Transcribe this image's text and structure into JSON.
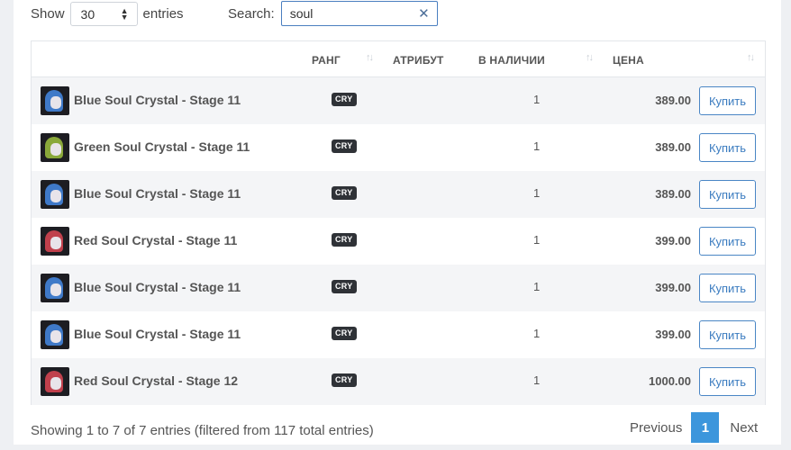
{
  "controls": {
    "show_label": "Show",
    "entries_value": "30",
    "entries_label": "entries",
    "search_label": "Search:",
    "search_value": "soul"
  },
  "table": {
    "headers": {
      "rank": "РАНГ",
      "attribute": "АТРИБУТ",
      "in_stock": "В НАЛИЧИИ",
      "price": "ЦЕНА"
    },
    "rows": [
      {
        "name": "Blue Soul Crystal - Stage 11",
        "rank": "CRY",
        "qty": "1",
        "price": "389.00",
        "buy": "Купить",
        "color": "#3f79c8"
      },
      {
        "name": "Green Soul Crystal - Stage 11",
        "rank": "CRY",
        "qty": "1",
        "price": "389.00",
        "buy": "Купить",
        "color": "#8aa83a"
      },
      {
        "name": "Blue Soul Crystal - Stage 11",
        "rank": "CRY",
        "qty": "1",
        "price": "389.00",
        "buy": "Купить",
        "color": "#3f79c8"
      },
      {
        "name": "Red Soul Crystal - Stage 11",
        "rank": "CRY",
        "qty": "1",
        "price": "399.00",
        "buy": "Купить",
        "color": "#c0404c"
      },
      {
        "name": "Blue Soul Crystal - Stage 11",
        "rank": "CRY",
        "qty": "1",
        "price": "399.00",
        "buy": "Купить",
        "color": "#3f79c8"
      },
      {
        "name": "Blue Soul Crystal - Stage 11",
        "rank": "CRY",
        "qty": "1",
        "price": "399.00",
        "buy": "Купить",
        "color": "#3f79c8"
      },
      {
        "name": "Red Soul Crystal - Stage 12",
        "rank": "CRY",
        "qty": "1",
        "price": "1000.00",
        "buy": "Купить",
        "color": "#c0404c"
      }
    ]
  },
  "footer": {
    "info": "Showing 1 to 7 of 7 entries (filtered from 117 total entries)",
    "previous": "Previous",
    "page": "1",
    "next": "Next"
  }
}
